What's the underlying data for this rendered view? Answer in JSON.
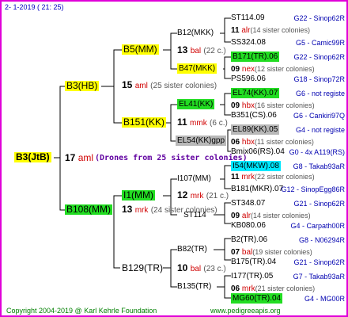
{
  "header": {
    "text": "2-   1-2019  (  21:  25)"
  },
  "root": {
    "label": "B3(JtB)",
    "num": "17",
    "code": "aml",
    "note": "(Drones from 25 sister colonies)"
  },
  "g1": [
    {
      "label": "B3(HB)",
      "num": "15",
      "code": "aml",
      "note": "(25 sister colonies)"
    },
    {
      "label": "B108(MM)",
      "num": "13",
      "code": "mrk",
      "note": "(24 sister colonies)"
    }
  ],
  "g2": [
    {
      "label": "B5(MM)",
      "num": "13",
      "code": "bal",
      "note": "(22 c.)"
    },
    {
      "label": "B151(KK)",
      "num": "11",
      "code": "mmk",
      "note": "(6 c.)"
    },
    {
      "label": "I1(MM)",
      "num": "12",
      "code": "mrk",
      "note": "(21 c.)"
    },
    {
      "label": "B129(TR)",
      "num": "10",
      "code": "bal",
      "note": "(23 c.)"
    }
  ],
  "g3": [
    {
      "label": "B12(MKK)"
    },
    {
      "label": "B47(MKK)"
    },
    {
      "label": "EL41(KK)"
    },
    {
      "label": "EL54(KK)gpp"
    },
    {
      "label": "I107(MM)"
    },
    {
      "label": "ST114"
    },
    {
      "label": "B82(TR)"
    },
    {
      "label": "B135(TR)"
    }
  ],
  "g4": [
    {
      "label": "ST114.09",
      "right": "G22 - Sinop62R"
    },
    {
      "num": "11",
      "code": "alr",
      "note": "(14 sister colonies)"
    },
    {
      "label": "SS324.08",
      "right": "G5 - Camic99R"
    },
    {
      "label": "B171(TR).06",
      "right": "G22 - Sinop62R"
    },
    {
      "num": "09",
      "code": "nex",
      "note": "(12 sister colonies)"
    },
    {
      "label": "PS596.06",
      "right": "G18 - Sinop72R"
    },
    {
      "label": "EL74(KK).07",
      "right": "G6 - not registe"
    },
    {
      "num": "09",
      "code": "hbx",
      "note": "(16 sister colonies)"
    },
    {
      "label": "B351(CS).06",
      "right": "G6 - Cankiri97Q"
    },
    {
      "label": "EL89(KK).05",
      "right": "G4 - not registe"
    },
    {
      "num": "06",
      "code": "hbx",
      "note": "(11 sister colonies)"
    },
    {
      "label": "Bmix06(RS).04",
      "right": "G0 - 4x A119(RS)"
    },
    {
      "label": "I54(MKW).08",
      "right": "G8 - Takab93aR"
    },
    {
      "num": "11",
      "code": "mrk",
      "note": "(22 sister colonies)"
    },
    {
      "label": "B181(MKR).07",
      "right": "G12 - SinopEgg86R"
    },
    {
      "label": "ST348.07",
      "right": "G21 - Sinop62R"
    },
    {
      "num": "09",
      "code": "alr",
      "note": "(14 sister colonies)"
    },
    {
      "label": "KB080.06",
      "right": "G4 - Carpath00R"
    },
    {
      "label": "B2(TR).06",
      "right": "G8 - N06294R"
    },
    {
      "num": "07",
      "code": "bal",
      "note": "(19 sister colonies)"
    },
    {
      "label": "B175(TR).04",
      "right": "G21 - Sinop62R"
    },
    {
      "label": "I177(TR).05",
      "right": "G7 - Takab93aR"
    },
    {
      "num": "06",
      "code": "mrk",
      "note": "(21 sister colonies)"
    },
    {
      "label": "MG60(TR).04",
      "right": "G4 - MG00R"
    }
  ],
  "footer": {
    "left": "Copyright 2004-2019 @ Karl Kehrle Foundation",
    "right": "www.pedigreeapis.org"
  }
}
